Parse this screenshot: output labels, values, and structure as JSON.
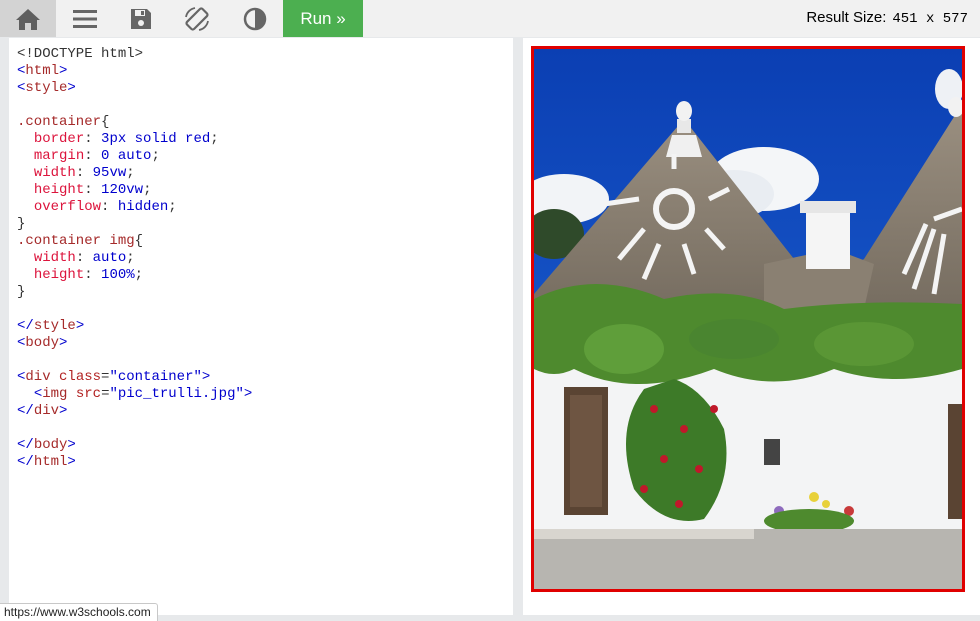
{
  "toolbar": {
    "icons": [
      "home-icon",
      "menu-icon",
      "save-icon",
      "rotate-icon",
      "theme-icon"
    ],
    "run_label": "Run »",
    "result_size_label": "Result Size:",
    "result_size_value": "451 x 577"
  },
  "code_lines": [
    [
      [
        "plain",
        "<!DOCTYPE html>"
      ]
    ],
    [
      [
        "br",
        "<"
      ],
      [
        "tag",
        "html"
      ],
      [
        "br",
        ">"
      ]
    ],
    [
      [
        "br",
        "<"
      ],
      [
        "tag",
        "style"
      ],
      [
        "br",
        ">"
      ]
    ],
    [],
    [
      [
        "sel",
        ".container"
      ],
      [
        "plain",
        "{"
      ]
    ],
    [
      [
        "plain",
        "  "
      ],
      [
        "prop",
        "border"
      ],
      [
        "plain",
        ": "
      ],
      [
        "pval",
        "3px solid red"
      ],
      [
        "plain",
        ";"
      ]
    ],
    [
      [
        "plain",
        "  "
      ],
      [
        "prop",
        "margin"
      ],
      [
        "plain",
        ": "
      ],
      [
        "pval",
        "0 auto"
      ],
      [
        "plain",
        ";"
      ]
    ],
    [
      [
        "plain",
        "  "
      ],
      [
        "prop",
        "width"
      ],
      [
        "plain",
        ": "
      ],
      [
        "pval",
        "95vw"
      ],
      [
        "plain",
        ";"
      ]
    ],
    [
      [
        "plain",
        "  "
      ],
      [
        "prop",
        "height"
      ],
      [
        "plain",
        ": "
      ],
      [
        "pval",
        "120vw"
      ],
      [
        "plain",
        ";"
      ]
    ],
    [
      [
        "plain",
        "  "
      ],
      [
        "prop",
        "overflow"
      ],
      [
        "plain",
        ": "
      ],
      [
        "pval",
        "hidden"
      ],
      [
        "plain",
        ";"
      ]
    ],
    [
      [
        "plain",
        "}"
      ]
    ],
    [
      [
        "sel",
        ".container img"
      ],
      [
        "plain",
        "{"
      ]
    ],
    [
      [
        "plain",
        "  "
      ],
      [
        "prop",
        "width"
      ],
      [
        "plain",
        ": "
      ],
      [
        "pval",
        "auto"
      ],
      [
        "plain",
        ";"
      ]
    ],
    [
      [
        "plain",
        "  "
      ],
      [
        "prop",
        "height"
      ],
      [
        "plain",
        ": "
      ],
      [
        "pval",
        "100%"
      ],
      [
        "plain",
        ";"
      ]
    ],
    [
      [
        "plain",
        "}"
      ]
    ],
    [],
    [
      [
        "br",
        "</"
      ],
      [
        "tag",
        "style"
      ],
      [
        "br",
        ">"
      ]
    ],
    [
      [
        "br",
        "<"
      ],
      [
        "tag",
        "body"
      ],
      [
        "br",
        ">"
      ]
    ],
    [],
    [
      [
        "br",
        "<"
      ],
      [
        "tag",
        "div"
      ],
      [
        "plain",
        " "
      ],
      [
        "attr",
        "class"
      ],
      [
        "plain",
        "="
      ],
      [
        "val",
        "\"container\""
      ],
      [
        "br",
        ">"
      ]
    ],
    [
      [
        "plain",
        "  "
      ],
      [
        "br",
        "<"
      ],
      [
        "tag",
        "img"
      ],
      [
        "plain",
        " "
      ],
      [
        "attr",
        "src"
      ],
      [
        "plain",
        "="
      ],
      [
        "val",
        "\"pic_trulli.jpg\""
      ],
      [
        "br",
        ">"
      ]
    ],
    [
      [
        "br",
        "</"
      ],
      [
        "tag",
        "div"
      ],
      [
        "br",
        ">"
      ]
    ],
    [],
    [
      [
        "br",
        "</"
      ],
      [
        "tag",
        "body"
      ],
      [
        "br",
        ">"
      ]
    ],
    [
      [
        "br",
        "</"
      ],
      [
        "tag",
        "html"
      ],
      [
        "br",
        ">"
      ]
    ]
  ],
  "result_image": "trulli-houses-photo",
  "status_url": "https://www.w3schools.com"
}
